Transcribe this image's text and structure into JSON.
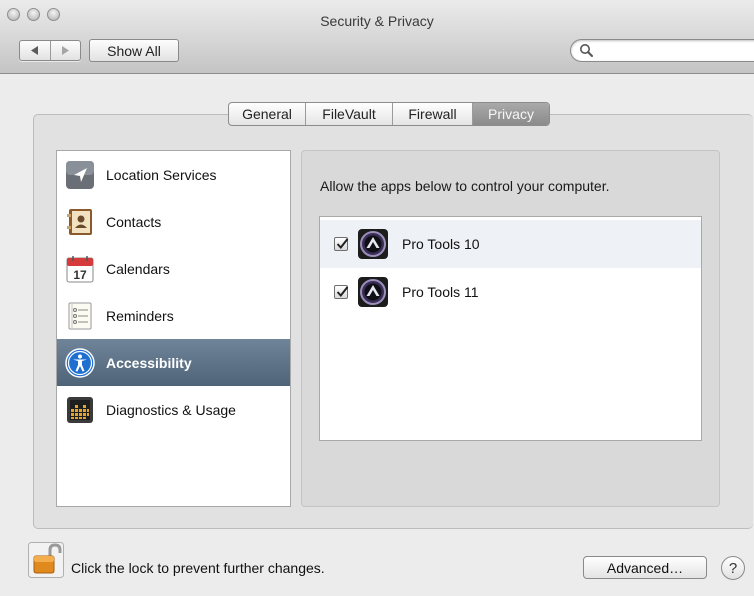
{
  "window": {
    "title": "Security & Privacy"
  },
  "toolbar": {
    "back_icon": "triangle-left-icon",
    "forward_icon": "triangle-right-icon",
    "show_all_label": "Show All",
    "search_placeholder": "",
    "search_value": ""
  },
  "tabs": [
    {
      "label": "General",
      "selected": false
    },
    {
      "label": "FileVault",
      "selected": false
    },
    {
      "label": "Firewall",
      "selected": false
    },
    {
      "label": "Privacy",
      "selected": true
    }
  ],
  "sidebar": {
    "items": [
      {
        "label": "Location Services",
        "icon": "location-arrow-icon",
        "selected": false
      },
      {
        "label": "Contacts",
        "icon": "contacts-book-icon",
        "selected": false
      },
      {
        "label": "Calendars",
        "icon": "calendar-icon",
        "calendar_day": "17",
        "selected": false
      },
      {
        "label": "Reminders",
        "icon": "reminders-list-icon",
        "selected": false
      },
      {
        "label": "Accessibility",
        "icon": "accessibility-icon",
        "selected": true
      },
      {
        "label": "Diagnostics & Usage",
        "icon": "diagnostics-grid-icon",
        "selected": false
      }
    ]
  },
  "detail": {
    "heading": "Allow the apps below to control your computer.",
    "apps": [
      {
        "name": "Pro Tools 10",
        "checked": true,
        "icon": "pro-tools-icon"
      },
      {
        "name": "Pro Tools 11",
        "checked": true,
        "icon": "pro-tools-icon"
      }
    ]
  },
  "footer": {
    "lock_icon": "unlocked-padlock-icon",
    "lock_text": "Click the lock to prevent further changes.",
    "advanced_label": "Advanced…",
    "help_label": "?"
  },
  "colors": {
    "selection_top": "#6f8499",
    "selection_bottom": "#4f6478",
    "selected_tab": "#8b8b8b",
    "window_bg": "#ececec"
  }
}
